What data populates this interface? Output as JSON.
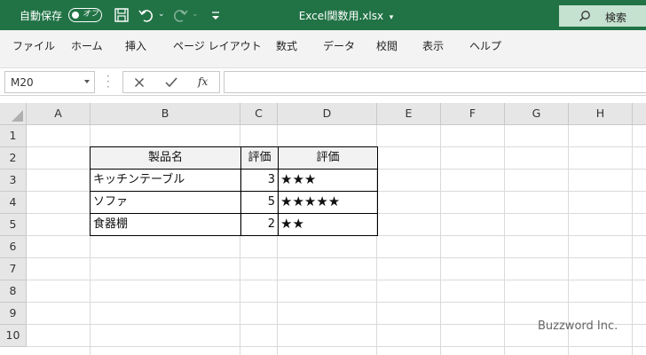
{
  "titlebar": {
    "autosave_label": "自動保存",
    "autosave_state": "オフ",
    "document_title": "Excel関数用.xlsx",
    "search_label": "検索",
    "bg_color": "#217346"
  },
  "ribbon": {
    "tabs": [
      "ファイル",
      "ホーム",
      "挿入",
      "ページ レイアウト",
      "数式",
      "データ",
      "校閲",
      "表示",
      "ヘルプ"
    ]
  },
  "formula_bar": {
    "name_box": "M20",
    "fx_label": "fx",
    "formula": ""
  },
  "sheet": {
    "columns": [
      "A",
      "B",
      "C",
      "D",
      "E",
      "F",
      "G",
      "H"
    ],
    "rows": [
      "1",
      "2",
      "3",
      "4",
      "5",
      "6",
      "7",
      "8",
      "9",
      "10"
    ],
    "table": {
      "header": [
        "製品名",
        "評価",
        "評価"
      ],
      "rows": [
        {
          "name": "キッチンテーブル",
          "rating": "3",
          "stars": "★★★"
        },
        {
          "name": "ソファ",
          "rating": "5",
          "stars": "★★★★★"
        },
        {
          "name": "食器棚",
          "rating": "2",
          "stars": "★★"
        }
      ]
    }
  },
  "watermark": "Buzzword Inc."
}
